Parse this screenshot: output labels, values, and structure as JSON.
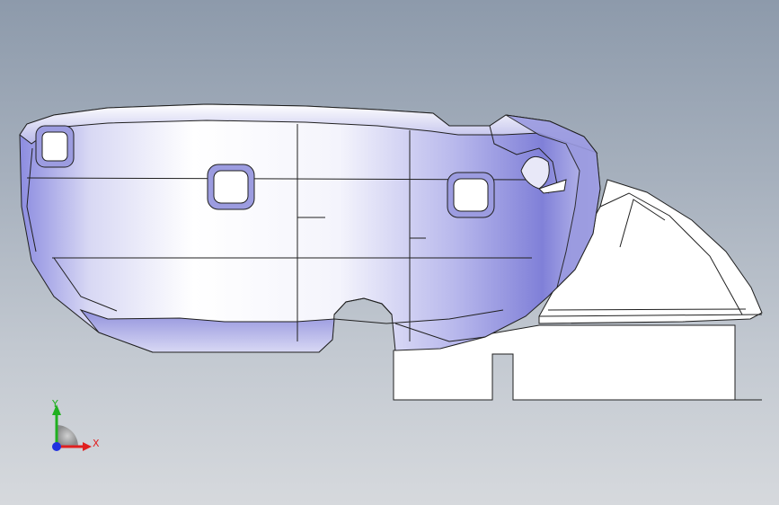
{
  "viewport": {
    "background_top": "#8d9aab",
    "background_bottom": "#d6d9dd"
  },
  "model": {
    "shell_color": "#ffffff",
    "shade_color": "#7a7ad8",
    "edge_color": "#202020",
    "base_color": "#ffffff"
  },
  "triad": {
    "x_label": "X",
    "y_label": "Y",
    "x_color": "#e02020",
    "y_color": "#20b020",
    "z_color": "#2030e0"
  }
}
